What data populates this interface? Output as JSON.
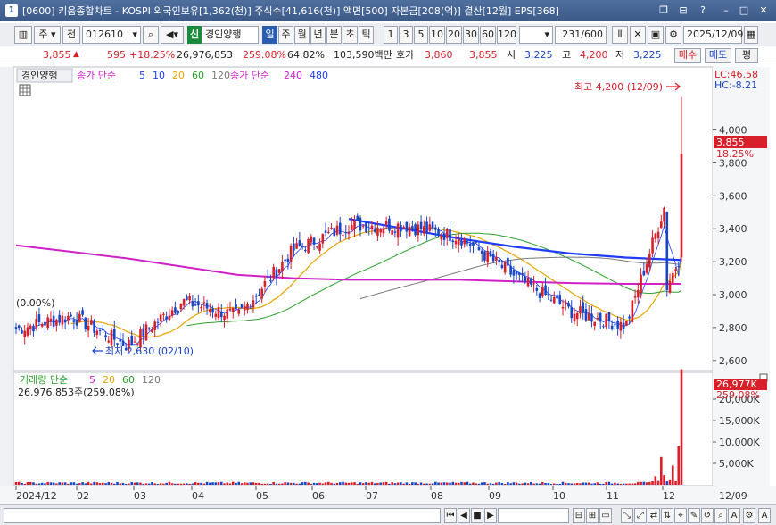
{
  "window": {
    "title": "[0600] 키움종합차트 - KOSPI 외국인보유[1,362(천)] 주식수[41,616(천)] 액면[500] 자본금[208(억)] 결산[12월] EPS[368]",
    "app_icon": "1"
  },
  "toolbar": {
    "period_type": "주",
    "period_prev": "전",
    "code": "012610",
    "market_badge": "신",
    "stock_name": "경인양행",
    "periods": [
      "일",
      "주",
      "월",
      "년",
      "분",
      "초",
      "틱"
    ],
    "selected_period": "일",
    "intervals": [
      "1",
      "3",
      "5",
      "10",
      "20",
      "30",
      "60",
      "120"
    ],
    "count": "231",
    "count_total": "/600",
    "date": "2025/12/09"
  },
  "quote": {
    "price": "3,855",
    "change": "595",
    "change_pct": "+18.25%",
    "volume": "26,976,853",
    "volume_pct": "259.08%",
    "turnover": "64.82%",
    "amount": "103,590백만",
    "ask_label": "호가",
    "ask": "3,860",
    "bid": "3,855",
    "open_label": "시",
    "open": "3,225",
    "high_label": "고",
    "high": "4,200",
    "low_label": "저",
    "low": "3,225",
    "buy": "매수",
    "sell": "매도",
    "eval": "평"
  },
  "price_panel": {
    "stock_tag": "경인양행",
    "legend_prefix": "종가 단순",
    "ma_legend": [
      {
        "label": "5",
        "color": "#1e3cff"
      },
      {
        "label": "10",
        "color": "#1e3cff"
      },
      {
        "label": "20",
        "color": "#e8a400"
      },
      {
        "label": "60",
        "color": "#2aa02a"
      },
      {
        "label": "120",
        "color": "#7a7a7a"
      }
    ],
    "legend2_prefix": "종가 단순",
    "ma_legend2": [
      {
        "label": "240",
        "color": "#d020c8"
      },
      {
        "label": "480",
        "color": "#1e3cff"
      }
    ],
    "lc": "LC:46.58",
    "hc": "HC:-8.21",
    "high_note": "최고 4,200 (12/09)",
    "low_note": "최저 2,630 (02/10)",
    "pct_note": "(0.00%)",
    "current_price": "3,855",
    "current_pct": "18.25%",
    "y_ticks": [
      "4,000",
      "3,800",
      "3,600",
      "3,400",
      "3,200",
      "3,000",
      "2,800",
      "2,600"
    ]
  },
  "volume_panel": {
    "legend_prefix": "거래량 단순",
    "ma_legend": [
      {
        "label": "5",
        "color": "#d020c8"
      },
      {
        "label": "20",
        "color": "#e8a400"
      },
      {
        "label": "60",
        "color": "#2aa02a"
      },
      {
        "label": "120",
        "color": "#7a7a7a"
      }
    ],
    "volume_note": "26,976,853주(259.08%)",
    "current_volume": "26,977K",
    "current_pct": "259.08%",
    "y_ticks": [
      "20,000K",
      "15,000K",
      "10,000K",
      "5,000K"
    ]
  },
  "x_axis": [
    "2024/12",
    "02",
    "03",
    "04",
    "05",
    "06",
    "07",
    "08",
    "09",
    "10",
    "11",
    "12",
    "12/09"
  ],
  "colors": {
    "up": "#d8202a",
    "down": "#1846c8",
    "ma5": "#1e3cff",
    "ma20": "#e8a400",
    "ma60": "#2aa02a",
    "ma120": "#7a7a7a",
    "ma240": "#d020c8",
    "ma480": "#1e3cff"
  },
  "chart_data": {
    "type": "candlestick",
    "x": [
      "2024-12",
      "2025-01",
      "2025-02",
      "2025-03",
      "2025-04",
      "2025-05",
      "2025-06",
      "2025-07",
      "2025-08",
      "2025-09",
      "2025-10",
      "2025-11",
      "2025-12-09"
    ],
    "close_approx": [
      2790,
      2870,
      2690,
      2960,
      2870,
      3270,
      3420,
      3420,
      3350,
      3110,
      2900,
      2810,
      3855
    ],
    "ma240_approx": [
      3300,
      3260,
      3220,
      3170,
      3120,
      3100,
      3090,
      3090,
      3090,
      3080,
      3070,
      3065,
      3065
    ],
    "ma480_approx": [
      null,
      null,
      null,
      null,
      null,
      null,
      3460,
      3400,
      3340,
      3290,
      3250,
      3225,
      3210
    ],
    "ylim": [
      2550,
      4350
    ],
    "annotations": [
      {
        "text": "최고 4,200 (12/09)"
      },
      {
        "text": "최저 2,630 (02/10)"
      }
    ],
    "volume_ylim": [
      0,
      25000
    ],
    "volume_unit": "K"
  }
}
